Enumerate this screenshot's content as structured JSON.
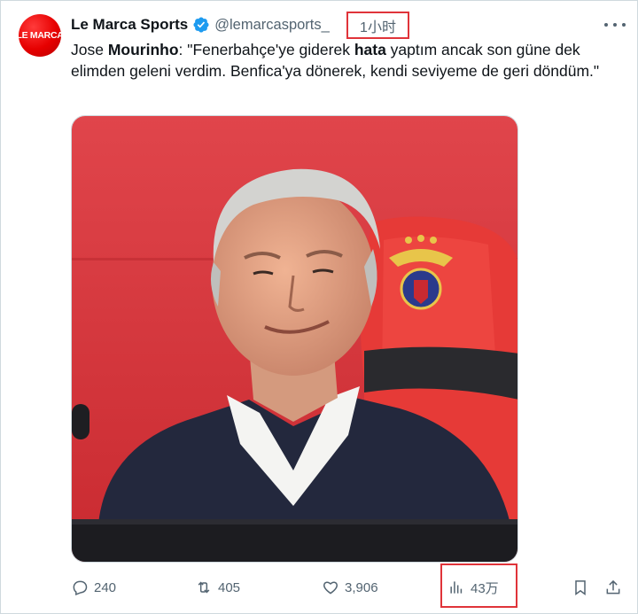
{
  "author": {
    "avatar_text": "LE MARCA",
    "name": "Le Marca Sports",
    "handle": "@lemarcasports_",
    "verified_icon": "verified-badge-icon",
    "timestamp": "1小时"
  },
  "tweet": {
    "text_parts": [
      "Jose ",
      "Mourinho",
      ": \"Fenerbahçe'ye giderek ",
      "hata",
      " yaptım ancak son güne dek elimden geleni verdim. Benfica'ya dönerek, kendi seviyeme de geri döndüm.\""
    ]
  },
  "actions": {
    "reply_count": "240",
    "retweet_count": "405",
    "like_count": "3,906",
    "views_count": "43万"
  },
  "icons": [
    "more-options-icon",
    "reply-icon",
    "retweet-icon",
    "like-icon",
    "views-icon",
    "bookmark-icon",
    "share-icon"
  ],
  "colors": {
    "accent": "#1d9bf0",
    "highlight_box": "#e0343a",
    "muted_text": "#536471",
    "brand_red": "#e60000"
  }
}
